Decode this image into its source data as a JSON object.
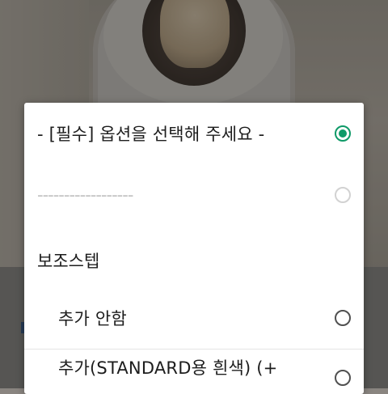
{
  "options": {
    "required_prompt": "- [필수] 옵션을 선택해 주세요 -",
    "separator": "------------------",
    "group_title": "보조스텝",
    "items": [
      {
        "label": "추가 안함"
      },
      {
        "label": "추가(STANDARD용 흰색) (+"
      }
    ]
  },
  "colors": {
    "selected_accent": "#0f9a68",
    "radio_border": "#505050",
    "disabled": "#c2c2c2"
  }
}
